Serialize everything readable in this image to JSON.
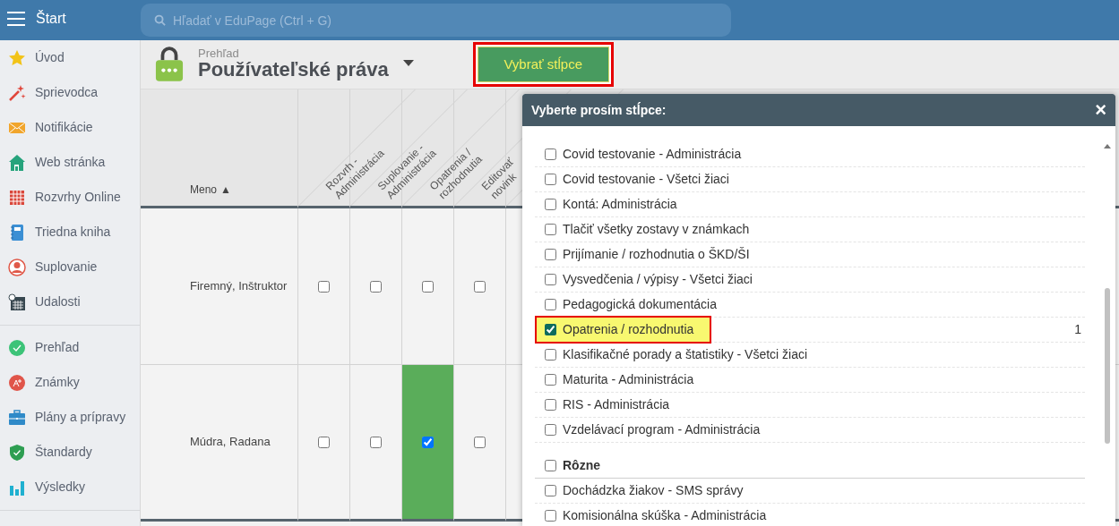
{
  "topbar": {
    "menu_label": "Štart",
    "search": {
      "placeholder": "Hľadať v EduPage (Ctrl + G)"
    }
  },
  "sidebar": {
    "groups": [
      [
        {
          "label": "Úvod"
        },
        {
          "label": "Sprievodca"
        },
        {
          "label": "Notifikácie"
        },
        {
          "label": "Web stránka"
        },
        {
          "label": "Rozvrhy Online"
        },
        {
          "label": "Triedna kniha"
        },
        {
          "label": "Suplovanie"
        },
        {
          "label": "Udalosti"
        }
      ],
      [
        {
          "label": "Prehľad"
        },
        {
          "label": "Známky"
        },
        {
          "label": "Plány a prípravy"
        },
        {
          "label": "Štandardy"
        },
        {
          "label": "Výsledky"
        }
      ]
    ]
  },
  "page_header": {
    "breadcrumb": "Prehľad",
    "title": "Používateľské práva",
    "button": {
      "label": "Vybrať stĺpce",
      "highlighted": true
    }
  },
  "table": {
    "name_header": "Meno",
    "sort_indicator": "▲",
    "columns": [
      "Rozvrh - Administrácia",
      "Suplovanie - Administrácia",
      "Opatrenia / rozhodnutia",
      "Editovať novink"
    ],
    "rows": [
      {
        "name": "Firemný, Inštruktor",
        "cells": [
          {
            "checked": false
          },
          {
            "checked": false
          },
          {
            "checked": false
          },
          {
            "checked": false
          }
        ]
      },
      {
        "name": "Múdra, Radana",
        "cells": [
          {
            "checked": false
          },
          {
            "checked": false
          },
          {
            "checked": true
          },
          {
            "checked": false
          }
        ]
      }
    ]
  },
  "dialog": {
    "title": "Vyberte prosím stĺpce:",
    "close": "×",
    "items": [
      {
        "kind": "option",
        "label": "Covid testovanie - Administrácia",
        "checked": false,
        "highlighted": false
      },
      {
        "kind": "option",
        "label": "Covid testovanie - Všetci žiaci",
        "checked": false,
        "highlighted": false
      },
      {
        "kind": "option",
        "label": "Kontá: Administrácia",
        "checked": false,
        "highlighted": false
      },
      {
        "kind": "option",
        "label": "Tlačiť všetky zostavy v známkach",
        "checked": false,
        "highlighted": false
      },
      {
        "kind": "option",
        "label": "Prijímanie / rozhodnutia o ŠKD/ŠI",
        "checked": false,
        "highlighted": false
      },
      {
        "kind": "option",
        "label": "Vysvedčenia / výpisy - Všetci žiaci",
        "checked": false,
        "highlighted": false
      },
      {
        "kind": "option",
        "label": "Pedagogická dokumentácia",
        "checked": false,
        "highlighted": false
      },
      {
        "kind": "option",
        "label": "Opatrenia / rozhodnutia",
        "checked": true,
        "highlighted": true,
        "count": "1"
      },
      {
        "kind": "option",
        "label": "Klasifikačné porady a štatistiky - Všetci žiaci",
        "checked": false,
        "highlighted": false
      },
      {
        "kind": "option",
        "label": "Maturita - Administrácia",
        "checked": false,
        "highlighted": false
      },
      {
        "kind": "option",
        "label": "RIS - Administrácia",
        "checked": false,
        "highlighted": false
      },
      {
        "kind": "option",
        "label": "Vzdelávací program - Administrácia",
        "checked": false,
        "highlighted": false
      },
      {
        "kind": "group",
        "label": "Rôzne",
        "checked": false
      },
      {
        "kind": "option",
        "label": "Dochádzka žiakov - SMS správy",
        "checked": false,
        "highlighted": false
      },
      {
        "kind": "option",
        "label": "Komisionálna skúška - Administrácia",
        "checked": false,
        "highlighted": false
      }
    ]
  }
}
